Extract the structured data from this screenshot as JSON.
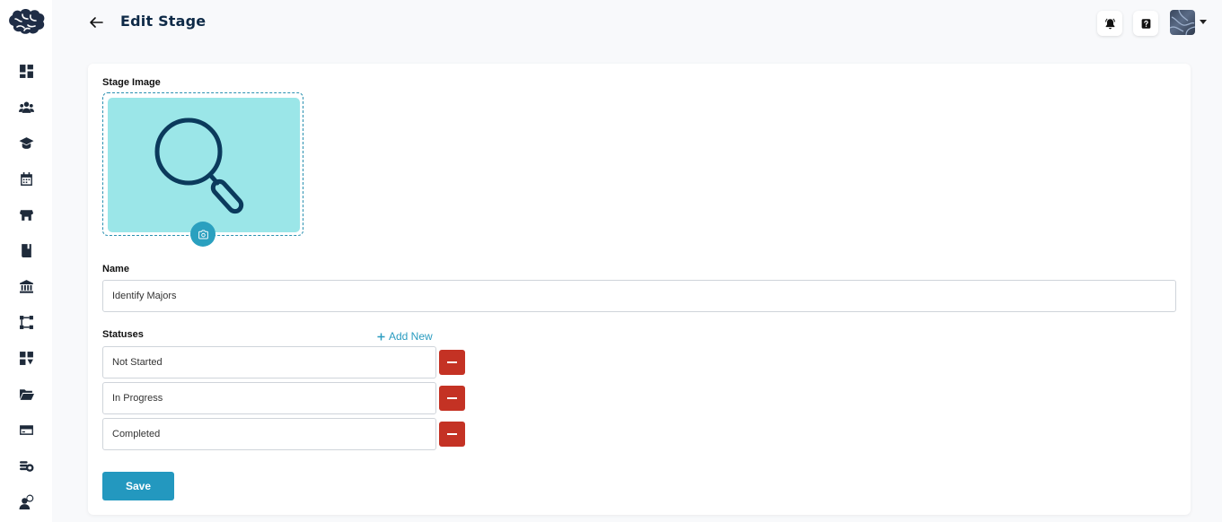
{
  "header": {
    "title": "Edit Stage",
    "back_icon": "arrow-left-icon",
    "notification_icon": "bell-icon",
    "help_icon": "question-icon"
  },
  "sidebar": {
    "items": [
      {
        "icon": "dashboard-icon"
      },
      {
        "icon": "users-icon"
      },
      {
        "icon": "graduation-cap-icon"
      },
      {
        "icon": "calendar-icon"
      },
      {
        "icon": "store-icon"
      },
      {
        "icon": "book-icon"
      },
      {
        "icon": "institution-icon"
      },
      {
        "icon": "workflow-icon"
      },
      {
        "icon": "apps-icon"
      },
      {
        "icon": "folder-icon"
      },
      {
        "icon": "credit-card-icon"
      },
      {
        "icon": "coins-icon"
      },
      {
        "icon": "user-chat-icon"
      }
    ]
  },
  "form": {
    "stage_image_label": "Stage Image",
    "name_label": "Name",
    "name_value": "Identify Majors",
    "statuses_label": "Statuses",
    "add_new_label": "Add New",
    "statuses": [
      "Not Started",
      "In Progress",
      "Completed"
    ],
    "save_label": "Save"
  },
  "colors": {
    "accent": "#2398bf",
    "danger": "#c43224",
    "image_bg": "#9be6e8",
    "title": "#0e2a47"
  }
}
